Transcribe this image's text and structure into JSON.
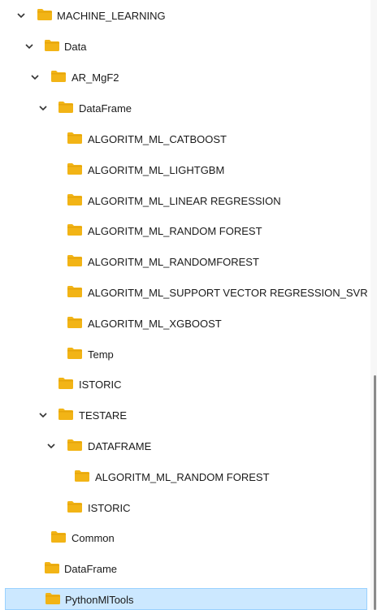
{
  "tree": {
    "items": [
      {
        "label": "MACHINE_LEARNING",
        "expanded": true
      },
      {
        "label": "Data",
        "expanded": true
      },
      {
        "label": "AR_MgF2",
        "expanded": true
      },
      {
        "label": "DataFrame",
        "expanded": true
      },
      {
        "label": "ALGORITM_ML_CATBOOST"
      },
      {
        "label": "ALGORITM_ML_LIGHTGBM"
      },
      {
        "label": "ALGORITM_ML_LINEAR REGRESSION"
      },
      {
        "label": "ALGORITM_ML_RANDOM FOREST"
      },
      {
        "label": "ALGORITM_ML_RANDOMFOREST"
      },
      {
        "label": "ALGORITM_ML_SUPPORT VECTOR REGRESSION_SVR"
      },
      {
        "label": "ALGORITM_ML_XGBOOST"
      },
      {
        "label": "Temp"
      },
      {
        "label": "ISTORIC"
      },
      {
        "label": "TESTARE",
        "expanded": true
      },
      {
        "label": "DATAFRAME",
        "expanded": true
      },
      {
        "label": "ALGORITM_ML_RANDOM FOREST"
      },
      {
        "label": "ISTORIC"
      },
      {
        "label": "Common"
      },
      {
        "label": "DataFrame"
      },
      {
        "label": "PythonMlTools",
        "selected": true
      }
    ]
  },
  "colors": {
    "folder": "#f2b416",
    "folder_tab": "#e3a20a",
    "selection_bg": "#cce8ff",
    "selection_border": "#99d1ff"
  },
  "icons": {
    "folder": "folder-icon",
    "expander": "chevron-down-icon"
  }
}
